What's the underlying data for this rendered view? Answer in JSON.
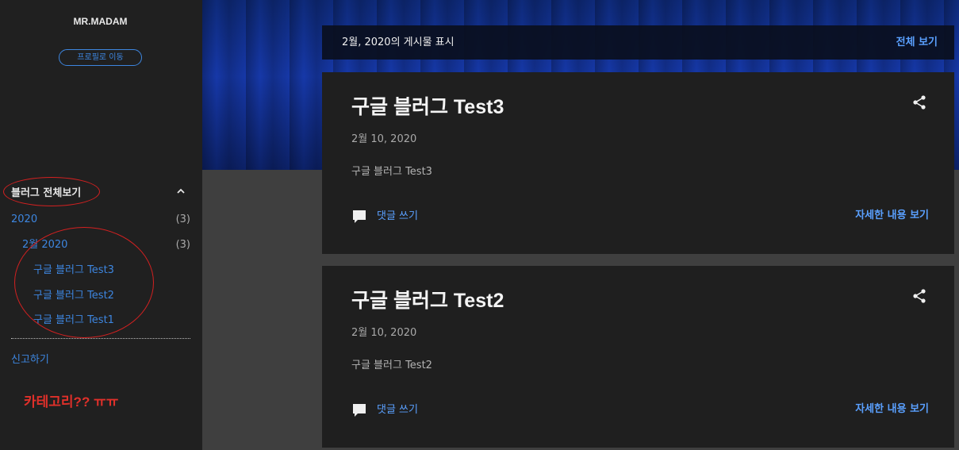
{
  "sidebar": {
    "blog_name": "MR.MADAM",
    "profile_button": "프로필로 이동",
    "archive_title": "블러그 전체보기",
    "archive": {
      "year": {
        "label": "2020",
        "count": "(3)"
      },
      "month": {
        "label": "2월 2020",
        "count": "(3)"
      },
      "posts": [
        "구글 블러그 Test3",
        "구글 블러그 Test2",
        "구글 블러그 Test1"
      ]
    },
    "report_link": "신고하기",
    "annotation": "카테고리?? ㅠㅠ"
  },
  "header": {
    "label": "2월, 2020의 게시물 표시",
    "view_all": "전체 보기"
  },
  "posts": [
    {
      "title": "구글 블러그 Test3",
      "date": "2월 10, 2020",
      "snippet": "구글 블러그 Test3",
      "comment_label": "댓글 쓰기",
      "read_more": "자세한 내용 보기"
    },
    {
      "title": "구글 블러그 Test2",
      "date": "2월 10, 2020",
      "snippet": "구글 블러그 Test2",
      "comment_label": "댓글 쓰기",
      "read_more": "자세한 내용 보기"
    }
  ],
  "colors": {
    "accent": "#3d86e0",
    "link_bright": "#5aa0ff",
    "annotation_red": "#e0302a"
  }
}
